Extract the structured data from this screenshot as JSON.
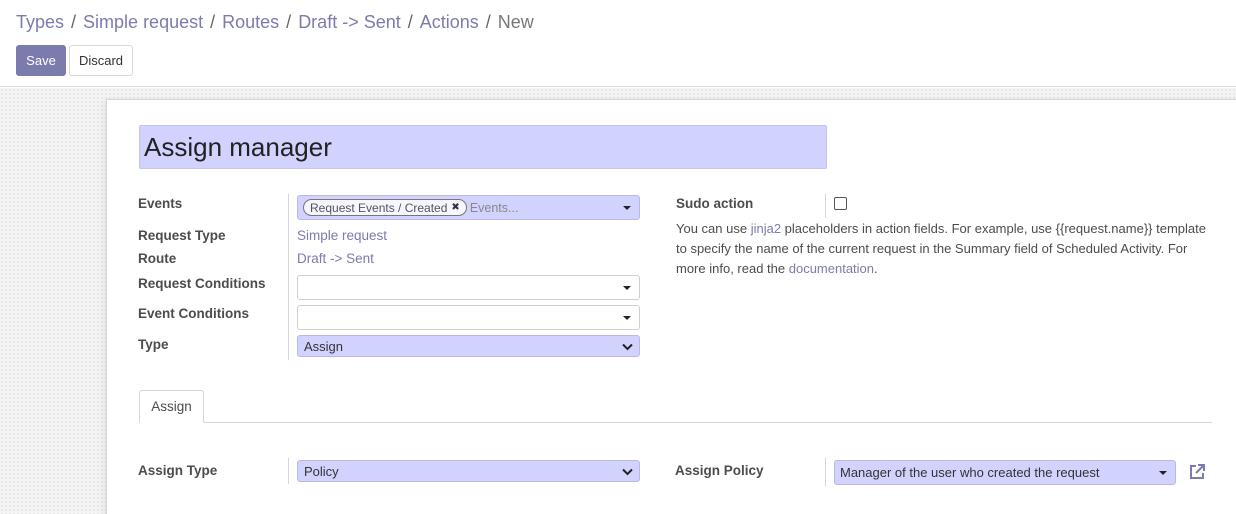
{
  "breadcrumb": [
    {
      "label": "Types"
    },
    {
      "label": "Simple request"
    },
    {
      "label": "Routes"
    },
    {
      "label": "Draft -> Sent"
    },
    {
      "label": "Actions"
    },
    {
      "label": "New"
    }
  ],
  "breadcrumb_separator": "/",
  "toolbar": {
    "save_label": "Save",
    "discard_label": "Discard"
  },
  "form": {
    "name": "Assign manager",
    "events": {
      "label": "Events",
      "tags": [
        "Request Events / Created"
      ],
      "placeholder": "Events..."
    },
    "request_type": {
      "label": "Request Type",
      "value": "Simple request"
    },
    "route": {
      "label": "Route",
      "value": "Draft -> Sent"
    },
    "request_conditions": {
      "label": "Request Conditions",
      "value": ""
    },
    "event_conditions": {
      "label": "Event Conditions",
      "value": ""
    },
    "type": {
      "label": "Type",
      "value": "Assign"
    },
    "sudo_action": {
      "label": "Sudo action",
      "checked": false
    },
    "help": {
      "part1": "You can use ",
      "link1": "jinja2",
      "part2": " placeholders in action fields. For example, use {{request.name}} template to specify the name of the current request in the Summary field of Scheduled Activity. For more info, read the ",
      "link2": "documentation",
      "part3": "."
    },
    "tabs": [
      {
        "label": "Assign",
        "active": true
      }
    ],
    "assign_type": {
      "label": "Assign Type",
      "value": "Policy"
    },
    "assign_policy": {
      "label": "Assign Policy",
      "value": "Manager of the user who created the request"
    }
  },
  "colors": {
    "primary": "#7c7bad",
    "required_bg": "#d2d2ff"
  },
  "icons": {
    "external_link": "external-link-icon",
    "remove_tag": "close-icon"
  }
}
